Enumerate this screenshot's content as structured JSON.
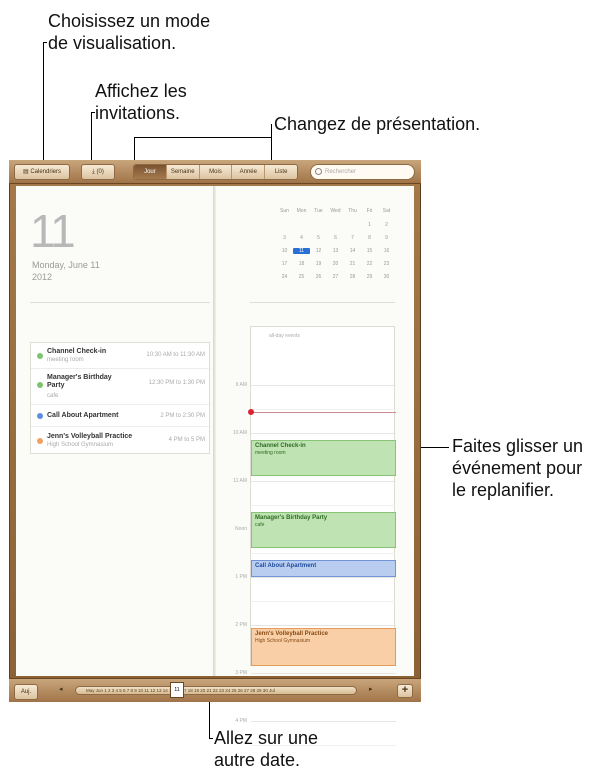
{
  "callouts": {
    "view_mode": [
      "Choisissez un mode",
      "de visualisation."
    ],
    "invitations": [
      "Affichez les",
      "invitations."
    ],
    "presentation": [
      "Changez de présentation."
    ],
    "drag_event": [
      "Faites glisser un",
      "événement pour",
      "le replanifier."
    ],
    "go_date": [
      "Allez sur une",
      "autre date."
    ]
  },
  "toolbar": {
    "calendars_label": "Calendriers",
    "invitations_label": "(0)",
    "tabs": [
      {
        "label": "Jour",
        "active": true
      },
      {
        "label": "Semaine",
        "active": false
      },
      {
        "label": "Mois",
        "active": false
      },
      {
        "label": "Année",
        "active": false
      },
      {
        "label": "Liste",
        "active": false
      }
    ],
    "search_placeholder": "Rechercher"
  },
  "left_page": {
    "big_day": "11",
    "date_line1": "Monday, June 11",
    "date_line2": "2012",
    "events": [
      {
        "title": "Channel Check-in",
        "sub": "meeting room",
        "time": "10:30 AM to 11:30 AM",
        "color": "#7cc46d"
      },
      {
        "title": "Manager's Birthday Party",
        "sub": "cafe",
        "time": "12:30 PM to 1:30 PM",
        "color": "#7cc46d"
      },
      {
        "title": "Call About Apartment",
        "sub": "",
        "time": "2 PM to 2:30 PM",
        "color": "#5b8fe0"
      },
      {
        "title": "Jenn's Volleyball Practice",
        "sub": "High School Gymnasium",
        "time": "4 PM to 5 PM",
        "color": "#f0a060"
      }
    ]
  },
  "mini_cal": {
    "weekdays": [
      "Sun",
      "Mon",
      "Tue",
      "Wed",
      "Thu",
      "Fri",
      "Sat"
    ],
    "rows": [
      [
        "",
        "",
        "",
        "",
        "",
        "1",
        "2"
      ],
      [
        "3",
        "4",
        "5",
        "6",
        "7",
        "8",
        "9"
      ],
      [
        "10",
        "11",
        "12",
        "13",
        "14",
        "15",
        "16"
      ],
      [
        "17",
        "18",
        "19",
        "20",
        "21",
        "22",
        "23"
      ],
      [
        "24",
        "25",
        "26",
        "27",
        "28",
        "29",
        "30"
      ]
    ],
    "selected": "11"
  },
  "dayview": {
    "allday": "all-day events",
    "hours": [
      "9 AM",
      "10 AM",
      "11 AM",
      "Noon",
      "1 PM",
      "2 PM",
      "3 PM",
      "4 PM"
    ],
    "blocks": [
      {
        "title": "Channel Check-in",
        "sub": "meeting room",
        "bg": "#bfe3b3",
        "border": "#86c374",
        "color": "#2e6b22"
      },
      {
        "title": "Manager's Birthday Party",
        "sub": "cafe",
        "bg": "#bfe3b3",
        "border": "#86c374",
        "color": "#2e6b22"
      },
      {
        "title": "Call About Apartment",
        "sub": "",
        "bg": "#b9cdf1",
        "border": "#6f95d6",
        "color": "#1f4c9a"
      },
      {
        "title": "Jenn's Volleyball Practice",
        "sub": "High School Gymnasium",
        "bg": "#f8cfa6",
        "border": "#e39a5a",
        "color": "#8a4a12"
      }
    ]
  },
  "bottombar": {
    "today_label": "Auj.",
    "timeline": "May     Jun  1  2  3  4  5  6  7  8  9  10  11  12  13  14  15  16  17  18  19  20  21  22  23  24  25  26  27  28  29  30     Jul",
    "current_day": "11",
    "plus": "+"
  }
}
